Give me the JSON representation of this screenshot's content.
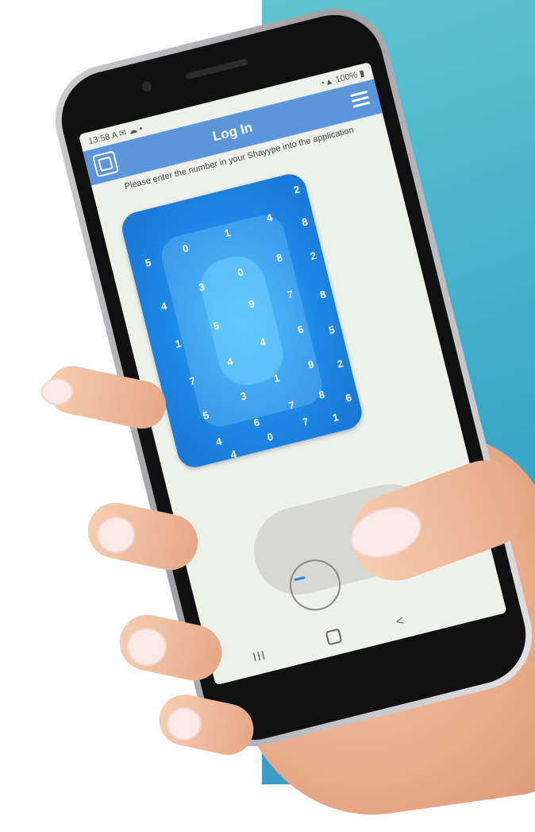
{
  "status_bar": {
    "time": "13:58",
    "icons_left": "A ✉ ☁ •",
    "battery": "100%"
  },
  "app_bar": {
    "title": "Log In",
    "logo_icon": "shayype-logo-icon",
    "menu_icon": "hamburger-menu-icon"
  },
  "instruction": "Please enter the number in your Shayype into the application",
  "pad": {
    "digits": [
      {
        "v": "5"
      },
      {
        "v": "0"
      },
      {
        "v": "1"
      },
      {
        "v": "4"
      },
      {
        "v": "2"
      },
      {
        "v": "8"
      },
      {
        "v": "4"
      },
      {
        "v": "3"
      },
      {
        "v": "0"
      },
      {
        "v": "8"
      },
      {
        "v": "2"
      },
      {
        "v": "1"
      },
      {
        "v": "5"
      },
      {
        "v": "9"
      },
      {
        "v": "7"
      },
      {
        "v": "8"
      },
      {
        "v": "7"
      },
      {
        "v": "4"
      },
      {
        "v": "4"
      },
      {
        "v": "6"
      },
      {
        "v": "5"
      },
      {
        "v": "5"
      },
      {
        "v": "3"
      },
      {
        "v": "1"
      },
      {
        "v": "9"
      },
      {
        "v": "2"
      },
      {
        "v": "4"
      },
      {
        "v": "6"
      },
      {
        "v": "7"
      },
      {
        "v": "8"
      },
      {
        "v": "6"
      },
      {
        "v": "4"
      },
      {
        "v": "0"
      },
      {
        "v": "7"
      },
      {
        "v": "1"
      }
    ]
  },
  "nav_bar": {
    "recent": "III",
    "back": "<"
  },
  "colors": {
    "teal_panel": "#4fb8cd",
    "app_bar": "#5d96d8",
    "pad_blue": "#1e88e5"
  }
}
